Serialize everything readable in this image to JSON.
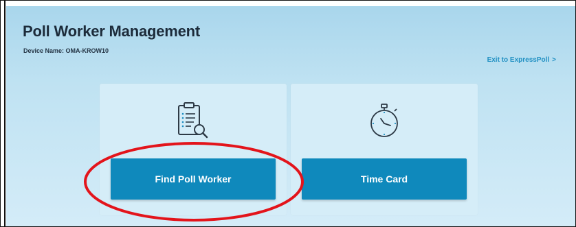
{
  "header": {
    "title": "Poll Worker Management",
    "device_label": "Device Name: OMA-KROW10",
    "exit_link": "Exit to ExpressPoll",
    "exit_chevron": ">"
  },
  "cards": {
    "find": {
      "button_label": "Find Poll Worker",
      "icon": "clipboard-search-icon"
    },
    "time": {
      "button_label": "Time Card",
      "icon": "stopwatch-icon"
    }
  },
  "colors": {
    "accent": "#0f89bc",
    "link": "#1f8fc2",
    "annotation": "#e3141b"
  }
}
